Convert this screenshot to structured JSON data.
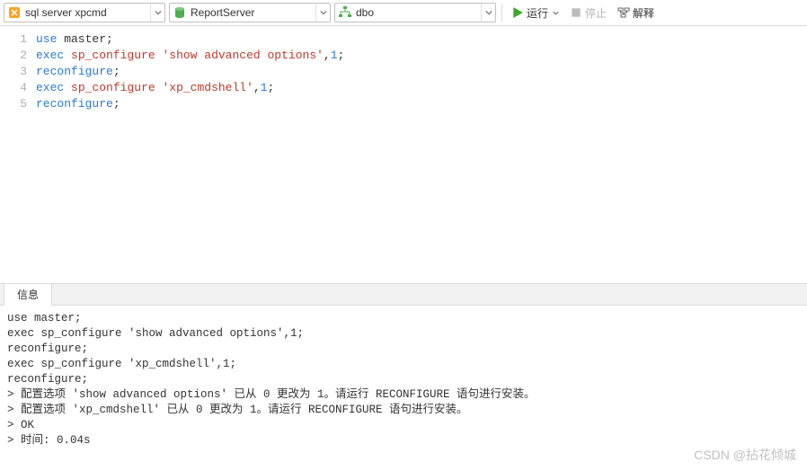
{
  "toolbar": {
    "connection": "sql server xpcmd",
    "database": "ReportServer",
    "schema": "dbo",
    "run_label": "运行",
    "stop_label": "停止",
    "explain_label": "解释"
  },
  "editor": {
    "lines": [
      {
        "n": "1",
        "tokens": [
          {
            "t": "use",
            "c": "kw"
          },
          {
            "t": " master;",
            "c": "pn"
          }
        ]
      },
      {
        "n": "2",
        "tokens": [
          {
            "t": "exec",
            "c": "kw"
          },
          {
            "t": " ",
            "c": "pn"
          },
          {
            "t": "sp_configure",
            "c": "fn"
          },
          {
            "t": " ",
            "c": "pn"
          },
          {
            "t": "'show advanced options'",
            "c": "str"
          },
          {
            "t": ",",
            "c": "pn"
          },
          {
            "t": "1",
            "c": "num"
          },
          {
            "t": ";",
            "c": "pn"
          }
        ]
      },
      {
        "n": "3",
        "tokens": [
          {
            "t": "reconfigure",
            "c": "kw"
          },
          {
            "t": ";",
            "c": "pn"
          }
        ]
      },
      {
        "n": "4",
        "tokens": [
          {
            "t": "exec",
            "c": "kw"
          },
          {
            "t": " ",
            "c": "pn"
          },
          {
            "t": "sp_configure",
            "c": "fn"
          },
          {
            "t": " ",
            "c": "pn"
          },
          {
            "t": "'xp_cmdshell'",
            "c": "str"
          },
          {
            "t": ",",
            "c": "pn"
          },
          {
            "t": "1",
            "c": "num"
          },
          {
            "t": ";",
            "c": "pn"
          }
        ]
      },
      {
        "n": "5",
        "tokens": [
          {
            "t": "reconfigure",
            "c": "kw"
          },
          {
            "t": ";",
            "c": "pn"
          }
        ]
      }
    ]
  },
  "panel": {
    "tab_label": "信息",
    "messages": [
      "use master;",
      "exec sp_configure 'show advanced options',1;",
      "reconfigure;",
      "exec sp_configure 'xp_cmdshell',1;",
      "reconfigure;",
      "> 配置选项 'show advanced options' 已从 0 更改为 1。请运行 RECONFIGURE 语句进行安装。",
      "> 配置选项 'xp_cmdshell' 已从 0 更改为 1。请运行 RECONFIGURE 语句进行安装。",
      "> OK",
      "> 时间: 0.04s"
    ]
  },
  "watermark": "CSDN @拈花倾城"
}
